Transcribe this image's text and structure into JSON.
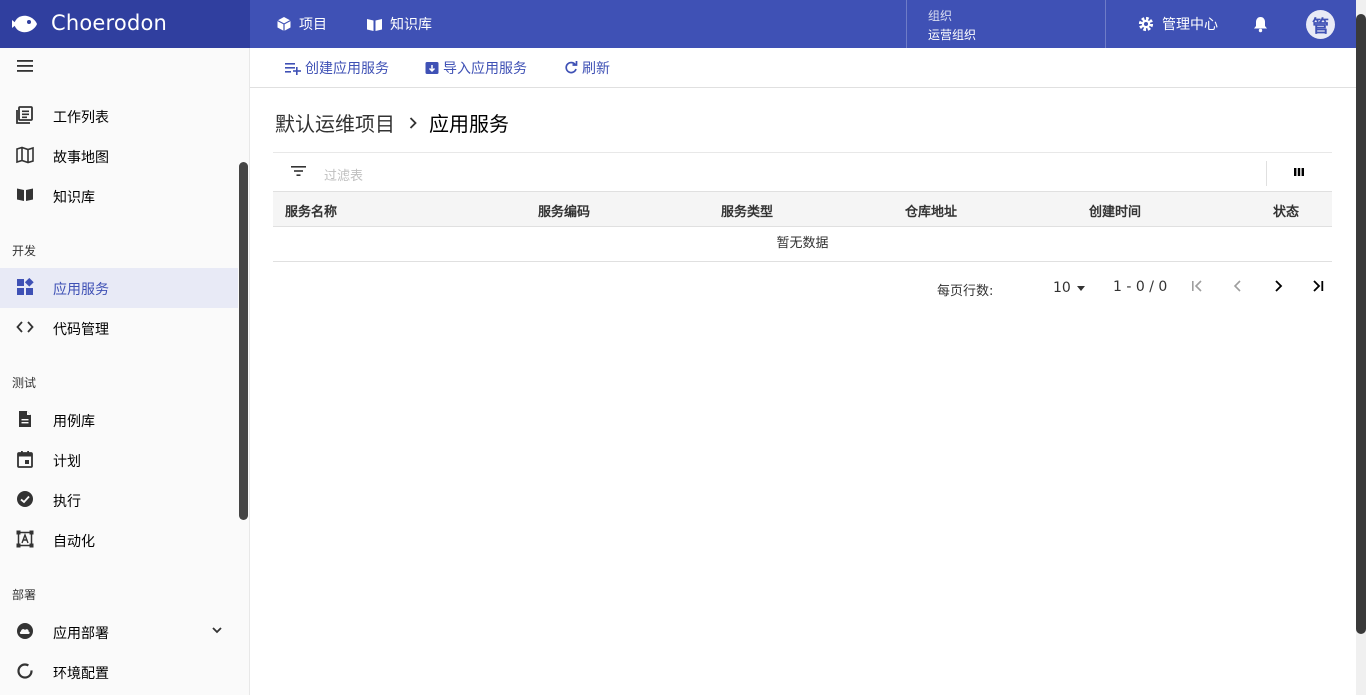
{
  "brand": {
    "name": "Choerodon"
  },
  "topnav": {
    "project": "项目",
    "knowledge": "知识库",
    "org_label": "组织",
    "org_value": "运营组织",
    "admin": "管理中心",
    "avatar": "管"
  },
  "sidebar": {
    "items_top": [
      {
        "label": "工作列表",
        "icon": "list-icon"
      },
      {
        "label": "故事地图",
        "icon": "map-icon"
      },
      {
        "label": "知识库",
        "icon": "book-icon"
      }
    ],
    "groups": [
      {
        "title": "开发",
        "items": [
          {
            "label": "应用服务",
            "active": true
          },
          {
            "label": "代码管理"
          }
        ]
      },
      {
        "title": "测试",
        "items": [
          {
            "label": "用例库"
          },
          {
            "label": "计划"
          },
          {
            "label": "执行"
          },
          {
            "label": "自动化"
          }
        ]
      },
      {
        "title": "部署",
        "items": [
          {
            "label": "应用部署"
          },
          {
            "label": "环境配置"
          }
        ]
      }
    ]
  },
  "toolbar": {
    "create": "创建应用服务",
    "import": "导入应用服务",
    "refresh": "刷新"
  },
  "breadcrumb": {
    "parent": "默认运维项目",
    "current": "应用服务"
  },
  "table": {
    "filter_placeholder": "过滤表",
    "columns": [
      "服务名称",
      "服务编码",
      "服务类型",
      "仓库地址",
      "创建时间",
      "状态"
    ],
    "empty": "暂无数据"
  },
  "pager": {
    "rows_label": "每页行数:",
    "page_size": "10",
    "range": "1 - 0 / 0"
  },
  "colors": {
    "primary": "#3f51b5",
    "primary_dark": "#303f9f",
    "active_bg": "#e8eaf6"
  }
}
